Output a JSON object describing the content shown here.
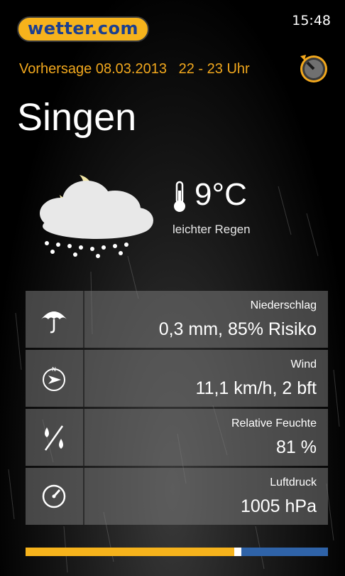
{
  "status_bar": {
    "time": "15:48"
  },
  "header": {
    "logo_text": "wetter.com",
    "forecast_text": "Vorhersage 08.03.2013   22 - 23 Uhr",
    "refresh_icon": "refresh-dial-icon"
  },
  "location": {
    "city": "Singen"
  },
  "current": {
    "icon": "moon-cloud-rain-icon",
    "temperature": "9°C",
    "condition": "leichter Regen"
  },
  "details": [
    {
      "icon": "umbrella-icon",
      "label": "Niederschlag",
      "value": "0,3 mm, 85% Risiko"
    },
    {
      "icon": "compass-wind-icon",
      "label": "Wind",
      "value": "11,1 km/h, 2 bft"
    },
    {
      "icon": "humidity-icon",
      "label": "Relative Feuchte",
      "value": "81 %"
    },
    {
      "icon": "pressure-gauge-icon",
      "label": "Luftdruck",
      "value": "1005 hPa"
    }
  ],
  "timeline": {
    "position_fraction": 0.69
  },
  "colors": {
    "accent_orange": "#f2a81d",
    "logo_yellow": "#f6b31c",
    "logo_blue": "#1b3f8f",
    "timeline_blue": "#2f63a8"
  }
}
